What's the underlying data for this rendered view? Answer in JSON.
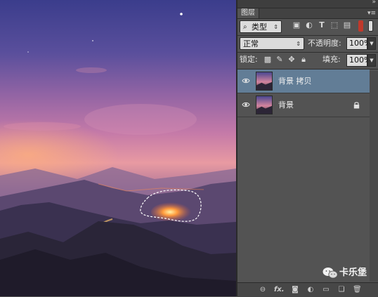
{
  "canvas": {
    "image_description_icon": "photo-canvas"
  },
  "panel": {
    "tab_label": "图层",
    "filter": {
      "label": "类型",
      "icon": "search-icon"
    },
    "blend_mode": "正常",
    "opacity": {
      "label": "不透明度:",
      "value": "100%"
    },
    "lock": {
      "label": "锁定:"
    },
    "fill": {
      "label": "填充:",
      "value": "100%"
    },
    "layers": [
      {
        "name": "背景 拷贝",
        "selected": true,
        "locked": false
      },
      {
        "name": "背景",
        "selected": false,
        "locked": true
      }
    ],
    "bottom_icons": [
      "link-icon",
      "fx-icon",
      "mask-icon",
      "adjustment-icon",
      "group-icon",
      "new-layer-icon",
      "trash-icon"
    ],
    "fx_label": "fx."
  },
  "watermark": {
    "text": "卡乐堡"
  },
  "colors": {
    "selected_layer": "#627d96",
    "panel_bg": "#535353",
    "swatch_red": "#c0392b"
  }
}
